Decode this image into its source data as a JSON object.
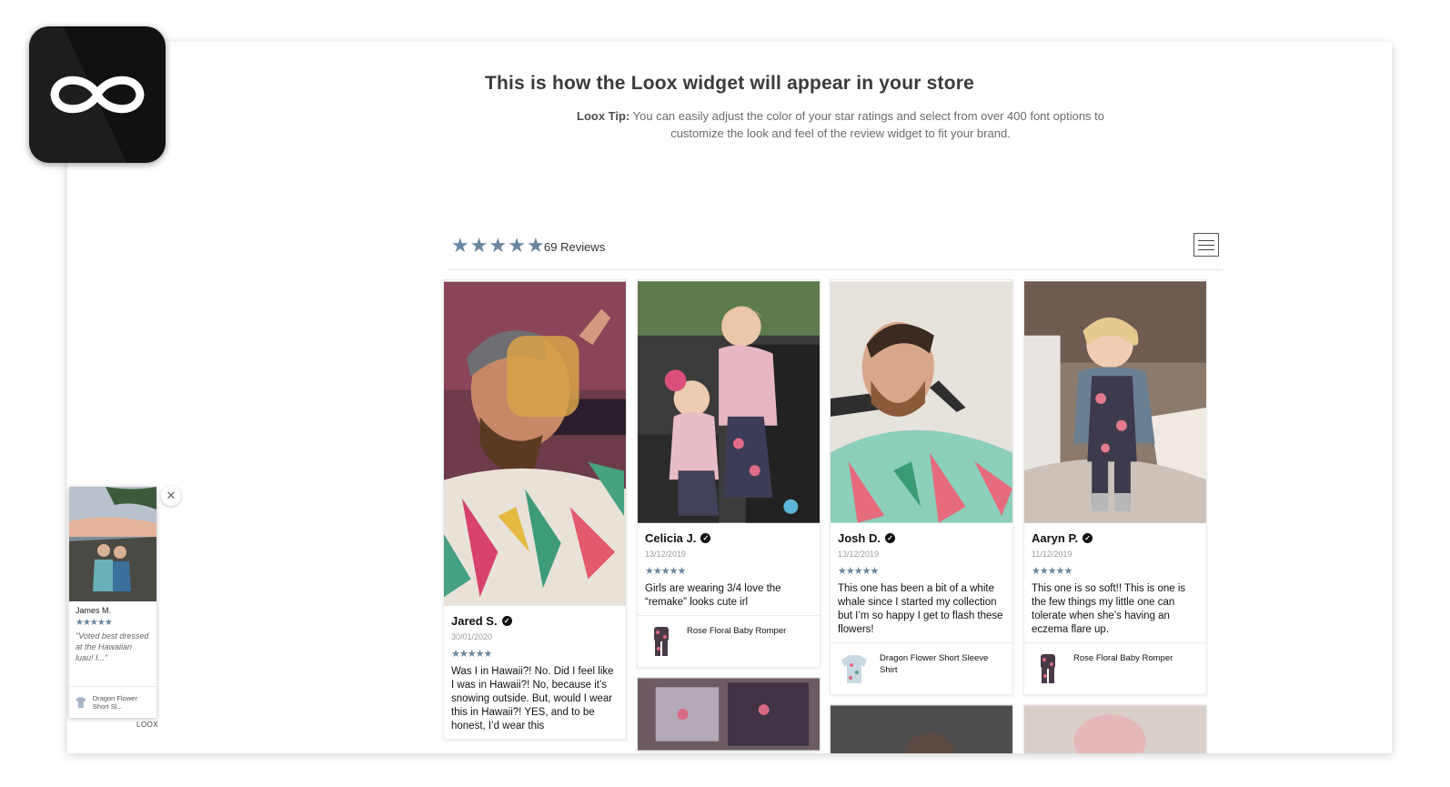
{
  "app": {
    "logo_icon": "infinity-icon"
  },
  "heading": "This is how the Loox widget will appear in your store",
  "tip": {
    "label": "Loox Tip:",
    "text": " You can easily adjust the color of your star ratings and select from over 400 font options to customize the look and feel of the review widget to fit your brand."
  },
  "summary": {
    "rating": 5,
    "count_label": "69 Reviews",
    "menu_icon": "hamburger-menu-icon"
  },
  "colors": {
    "star": "#6a85a0",
    "logo_bg": "#111111"
  },
  "reviews": [
    {
      "name": "Jared S.",
      "date": "30/01/2020",
      "stars": 5,
      "text": "Was I in Hawaii?! No. Did I feel like I was in Hawaii?! No, because it’s snowing outside. But, would I wear this in Hawaii?! YES, and to be honest, I’d wear this"
    },
    {
      "name": "Celicia J.",
      "date": "13/12/2019",
      "stars": 5,
      "text": "Girls are wearing 3/4 love the “remake” looks cute irl",
      "product": "Rose Floral Baby Romper"
    },
    {
      "name": "Josh D.",
      "date": "13/12/2019",
      "stars": 5,
      "text": "This one has been a bit of a white whale since I started my collection but I’m so happy I get to flash these flowers!",
      "product": "Dragon Flower Short Sleeve Shirt"
    },
    {
      "name": "Aaryn P.",
      "date": "11/12/2019",
      "stars": 5,
      "text": "This one is so soft!! This is one is the few things my little one can tolerate when she’s having an eczema flare up.",
      "product": "Rose Floral Baby Romper"
    }
  ],
  "popup": {
    "name": "James M.",
    "stars": 5,
    "quote": "\"Voted best dressed at the Hawaiian luau! I...\"",
    "product": "Dragon Flower Short Sl...",
    "close_icon": "close-icon",
    "brand": "LOOX"
  }
}
